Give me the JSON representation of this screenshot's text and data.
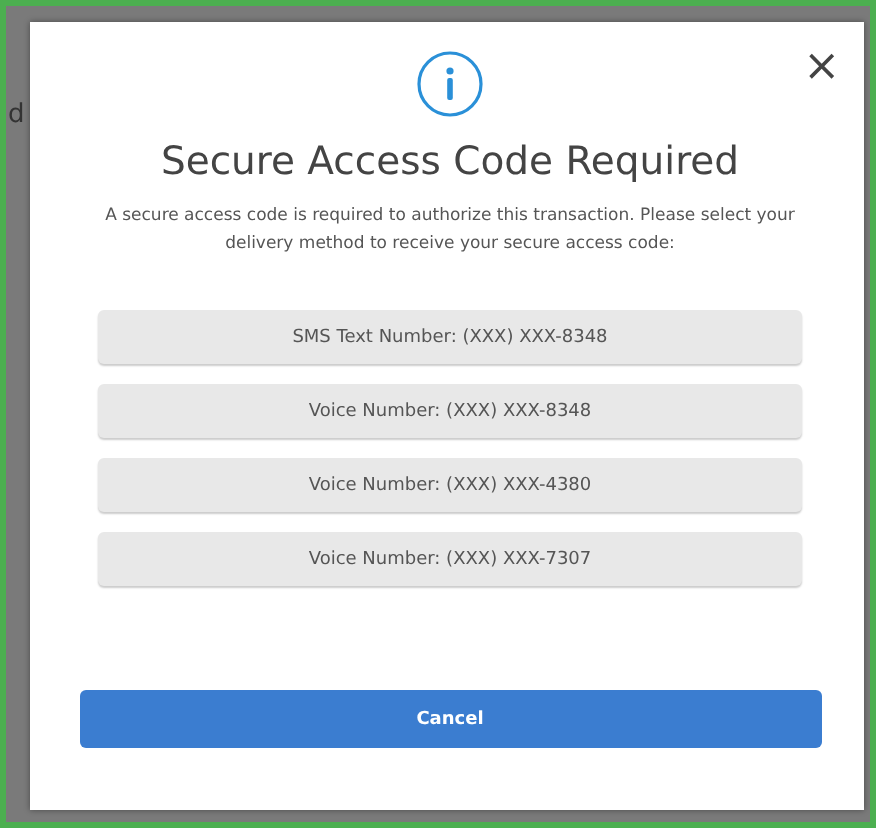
{
  "backdrop": {
    "text": "d"
  },
  "dialog": {
    "close": "×",
    "title": "Secure Access Code Required",
    "message": "A secure access code is required to authorize this transaction. Please select your delivery method to receive your secure access code:",
    "options": [
      "SMS Text Number: (XXX) XXX-8348",
      "Voice Number: (XXX) XXX-8348",
      "Voice Number: (XXX) XXX-4380",
      "Voice Number: (XXX) XXX-7307"
    ],
    "cancel": "Cancel"
  }
}
